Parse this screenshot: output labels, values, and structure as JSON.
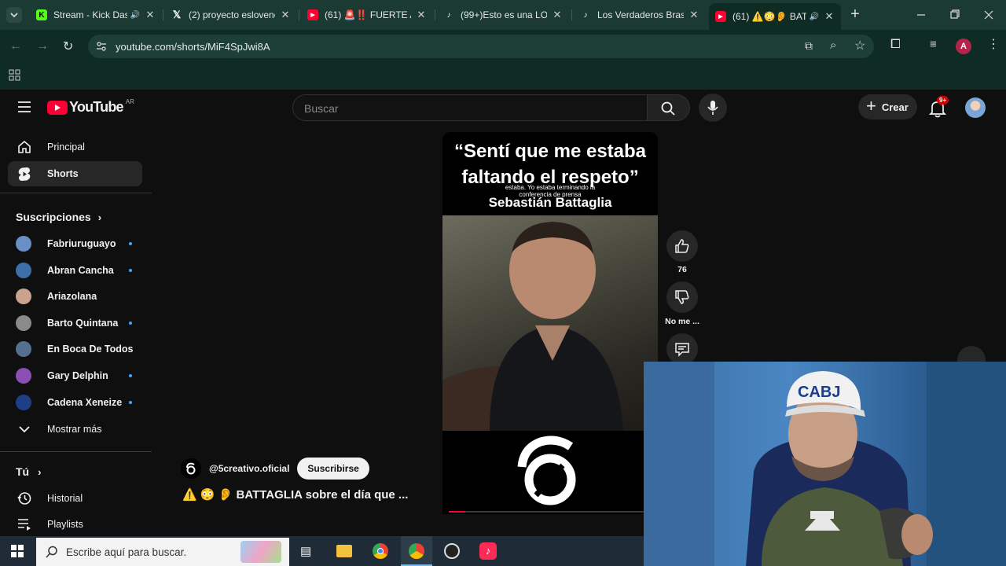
{
  "browser": {
    "tabs": [
      {
        "title": "Stream - Kick Das",
        "favicon": "kick-icon",
        "color": "#53fc18"
      },
      {
        "title": "(2) proyecto esloveno",
        "favicon": "x-icon",
        "color": "#ffffff"
      },
      {
        "title": "(61) 🚨‼️ FUERTE AM",
        "favicon": "youtube-icon",
        "color": "#ff0033"
      },
      {
        "title": "(99+)Esto es una LOC",
        "favicon": "tiktok-icon",
        "color": "#ffffff"
      },
      {
        "title": "Los Verdaderos Brasil",
        "favicon": "tiktok-icon",
        "color": "#ffffff"
      },
      {
        "title": "(61) ⚠️😳👂 BAT",
        "favicon": "youtube-icon",
        "color": "#ff0033"
      }
    ],
    "url": "youtube.com/shorts/MiF4SpJwi8A",
    "profile_initial": "A"
  },
  "youtube": {
    "logo_text": "YouTube",
    "region": "AR",
    "search_placeholder": "Buscar",
    "create_label": "Crear",
    "notifications_badge": "9+",
    "sidebar": {
      "main": [
        {
          "label": "Principal",
          "icon": "home-icon"
        },
        {
          "label": "Shorts",
          "icon": "shorts-icon"
        }
      ],
      "subscriptions_heading": "Suscripciones",
      "subscriptions": [
        {
          "name": "Fabriuruguayo",
          "dot": true,
          "color": "#6a8fc7"
        },
        {
          "name": "Abran Cancha",
          "dot": true,
          "color": "#3d6fa8"
        },
        {
          "name": "Ariazolana",
          "dot": false,
          "color": "#c9a38e"
        },
        {
          "name": "Barto Quintana",
          "dot": true,
          "color": "#8a8a8a"
        },
        {
          "name": "En Boca De Todos",
          "dot": false,
          "color": "#556f8f"
        },
        {
          "name": "Gary Delphin",
          "dot": true,
          "color": "#8a4fb5"
        },
        {
          "name": "Cadena Xeneize",
          "dot": true,
          "color": "#1d3f86"
        }
      ],
      "show_more": "Mostrar más",
      "you_heading": "Tú",
      "you_items": [
        {
          "label": "Historial",
          "icon": "history-icon"
        },
        {
          "label": "Playlists",
          "icon": "playlists-icon"
        }
      ]
    },
    "short": {
      "quote": "“Sentí que me estaba faltando el respeto”",
      "caption_overlay": "estaba. Yo estaba terminando la conferencia de prensa",
      "speaker": "Sebastián Battaglia",
      "progress": 0.08,
      "likes": "76",
      "dislike_label": "No me ...",
      "channel": "@5creativo.oficial",
      "subscribe_label": "Suscribirse",
      "title": "⚠️ 😳 👂 BATTAGLIA sobre el día que ..."
    },
    "webcam_cap_text": "CABJ"
  },
  "taskbar": {
    "search_placeholder": "Escribe aquí para buscar."
  }
}
